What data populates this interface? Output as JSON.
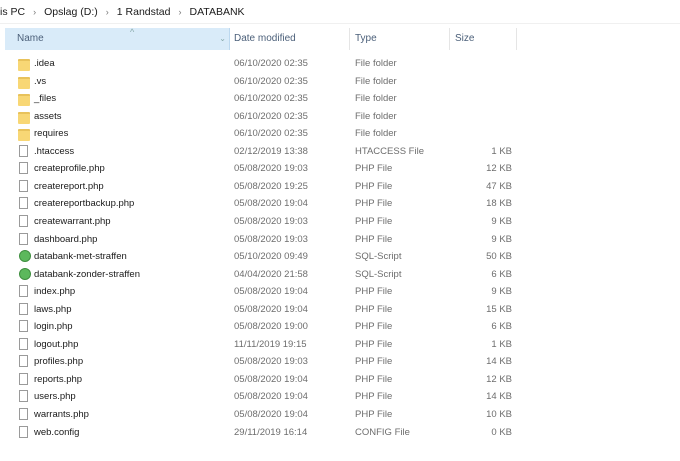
{
  "breadcrumb": [
    "is PC",
    "Opslag (D:)",
    "1 Randstad",
    "DATABANK"
  ],
  "columns": {
    "name": "Name",
    "date": "Date modified",
    "type": "Type",
    "size": "Size"
  },
  "files": [
    {
      "name": ".idea",
      "date": "06/10/2020 02:35",
      "type": "File folder",
      "size": "",
      "icon": "folder"
    },
    {
      "name": ".vs",
      "date": "06/10/2020 02:35",
      "type": "File folder",
      "size": "",
      "icon": "folder"
    },
    {
      "name": "_files",
      "date": "06/10/2020 02:35",
      "type": "File folder",
      "size": "",
      "icon": "folder"
    },
    {
      "name": "assets",
      "date": "06/10/2020 02:35",
      "type": "File folder",
      "size": "",
      "icon": "folder"
    },
    {
      "name": "requires",
      "date": "06/10/2020 02:35",
      "type": "File folder",
      "size": "",
      "icon": "folder"
    },
    {
      "name": ".htaccess",
      "date": "02/12/2019 13:38",
      "type": "HTACCESS File",
      "size": "1 KB",
      "icon": "file"
    },
    {
      "name": "createprofile.php",
      "date": "05/08/2020 19:03",
      "type": "PHP File",
      "size": "12 KB",
      "icon": "file"
    },
    {
      "name": "createreport.php",
      "date": "05/08/2020 19:25",
      "type": "PHP File",
      "size": "47 KB",
      "icon": "file"
    },
    {
      "name": "createreportbackup.php",
      "date": "05/08/2020 19:04",
      "type": "PHP File",
      "size": "18 KB",
      "icon": "file"
    },
    {
      "name": "createwarrant.php",
      "date": "05/08/2020 19:03",
      "type": "PHP File",
      "size": "9 KB",
      "icon": "file"
    },
    {
      "name": "dashboard.php",
      "date": "05/08/2020 19:03",
      "type": "PHP File",
      "size": "9 KB",
      "icon": "file"
    },
    {
      "name": "databank-met-straffen",
      "date": "05/10/2020 09:49",
      "type": "SQL-Script",
      "size": "50 KB",
      "icon": "sql"
    },
    {
      "name": "databank-zonder-straffen",
      "date": "04/04/2020 21:58",
      "type": "SQL-Script",
      "size": "6 KB",
      "icon": "sql"
    },
    {
      "name": "index.php",
      "date": "05/08/2020 19:04",
      "type": "PHP File",
      "size": "9 KB",
      "icon": "file"
    },
    {
      "name": "laws.php",
      "date": "05/08/2020 19:04",
      "type": "PHP File",
      "size": "15 KB",
      "icon": "file"
    },
    {
      "name": "login.php",
      "date": "05/08/2020 19:00",
      "type": "PHP File",
      "size": "6 KB",
      "icon": "file"
    },
    {
      "name": "logout.php",
      "date": "11/11/2019 19:15",
      "type": "PHP File",
      "size": "1 KB",
      "icon": "file"
    },
    {
      "name": "profiles.php",
      "date": "05/08/2020 19:03",
      "type": "PHP File",
      "size": "14 KB",
      "icon": "file"
    },
    {
      "name": "reports.php",
      "date": "05/08/2020 19:04",
      "type": "PHP File",
      "size": "12 KB",
      "icon": "file"
    },
    {
      "name": "users.php",
      "date": "05/08/2020 19:04",
      "type": "PHP File",
      "size": "14 KB",
      "icon": "file"
    },
    {
      "name": "warrants.php",
      "date": "05/08/2020 19:04",
      "type": "PHP File",
      "size": "10 KB",
      "icon": "file"
    },
    {
      "name": "web.config",
      "date": "29/11/2019 16:14",
      "type": "CONFIG File",
      "size": "0 KB",
      "icon": "file"
    }
  ]
}
